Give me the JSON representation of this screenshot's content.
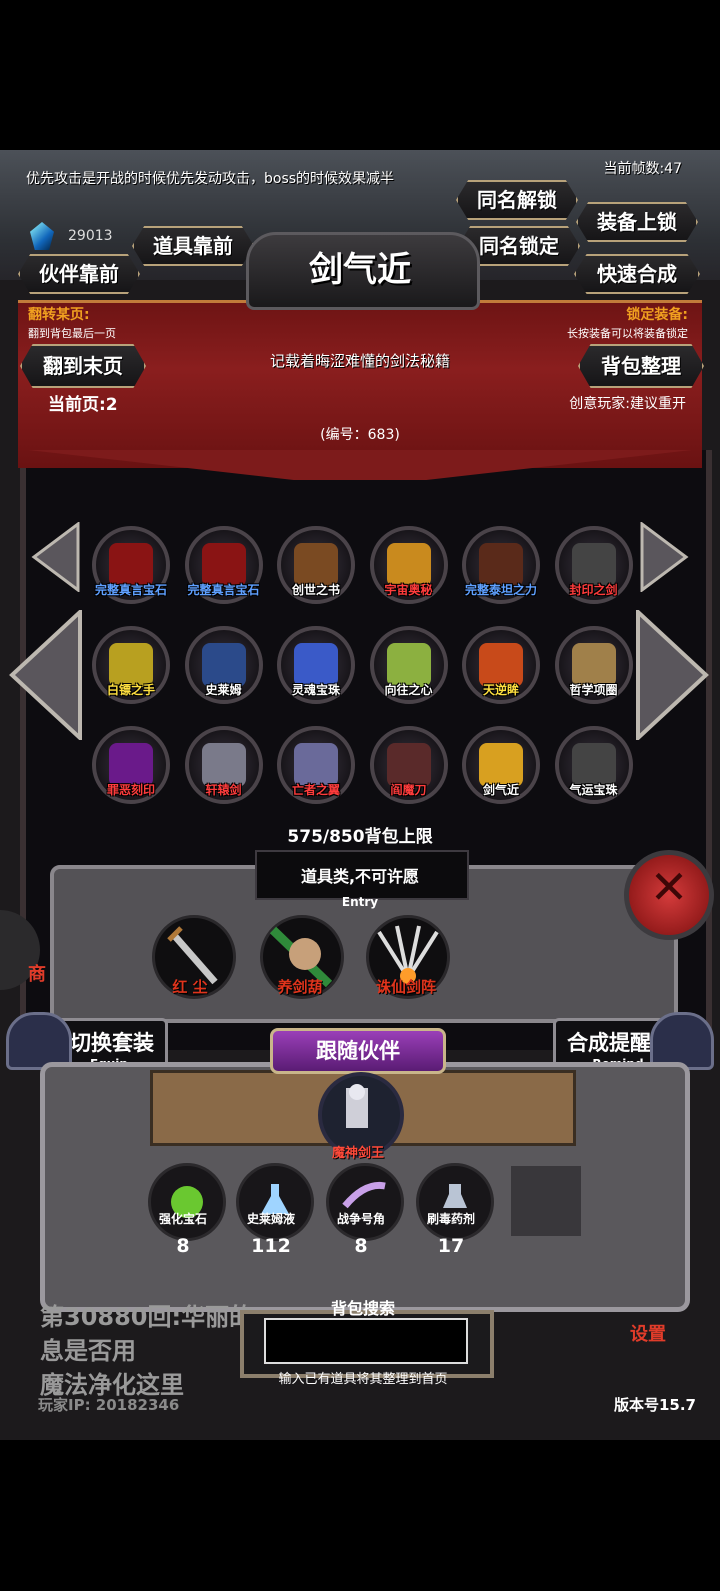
{
  "hud": {
    "tip": "优先攻击是开战的时候优先发动攻击，boss的时候效果减半",
    "fps": "当前帧数:47",
    "coins": "29013"
  },
  "buttons": {
    "name_unlock": "同名解锁",
    "equip_lock": "装备上锁",
    "item_first": "道具靠前",
    "name_lock": "同名锁定",
    "partner_first": "伙伴靠前",
    "quick_merge": "快速合成",
    "last_page": "翻到末页",
    "bag_sort": "背包整理"
  },
  "item_detail": {
    "title": "剑气近",
    "description": "记载着晦涩难懂的剑法秘籍",
    "number": "(编号：683)",
    "flip_label": "翻转某页:",
    "flip_sub": "翻到背包最后一页",
    "lock_label": "锁定装备:",
    "lock_sub": "长按装备可以将装备锁定",
    "current_page": "当前页:2",
    "creative": "创意玩家:建议重开"
  },
  "grid": [
    {
      "label": "完整真言宝石",
      "color": "#5fa0ff"
    },
    {
      "label": "完整真言宝石",
      "color": "#5fa0ff"
    },
    {
      "label": "创世之书",
      "color": "#ffffff"
    },
    {
      "label": "宇宙奥秘",
      "color": "#ff3c3c"
    },
    {
      "label": "完整泰坦之力",
      "color": "#5fa0ff"
    },
    {
      "label": "封印之剑",
      "color": "#ff3c3c"
    },
    {
      "label": "白镖之手",
      "color": "#ffe040"
    },
    {
      "label": "史莱姆",
      "color": "#ffffff"
    },
    {
      "label": "灵魂宝珠",
      "color": "#ffffff"
    },
    {
      "label": "向往之心",
      "color": "#ffffff"
    },
    {
      "label": "天逆眸",
      "color": "#ffe040"
    },
    {
      "label": "哲学项圈",
      "color": "#ffffff"
    },
    {
      "label": "罪恶刻印",
      "color": "#ff3c3c"
    },
    {
      "label": "轩辕剑",
      "color": "#ff3c3c"
    },
    {
      "label": "亡者之翼",
      "color": "#ff3c3c"
    },
    {
      "label": "阎魔刀",
      "color": "#ff3c3c"
    },
    {
      "label": "剑气近",
      "color": "#ffffff"
    },
    {
      "label": "气运宝珠",
      "color": "#ffffff"
    }
  ],
  "bag_limit": "575/850背包上限",
  "entry": {
    "title": "道具类,不可许愿",
    "sub": "Entry",
    "skills": [
      "红 尘",
      "养剑葫",
      "诛仙剑阵"
    ]
  },
  "equip": {
    "label": "切换套装",
    "sub": "Equip"
  },
  "remind": {
    "label": "合成提醒",
    "sub": "Remind"
  },
  "follow": {
    "label": "跟随伙伴",
    "partner": "魔神剑王"
  },
  "inventory": [
    {
      "label": "强化宝石",
      "count": "8"
    },
    {
      "label": "史莱姆液",
      "count": "112"
    },
    {
      "label": "战争号角",
      "count": "8"
    },
    {
      "label": "刷毒药剂",
      "count": "17"
    }
  ],
  "left_partial": "商",
  "story": "第30880回:华丽的　　　　　　　　　　　　　　　　　　　　　　　　　　　　　　　　　　　　　　　　　　　　　　　　　　　　　　　　　　　　　　　　　　　　息是否用",
  "story2": "魔法净化这里",
  "search": {
    "title": "背包搜索",
    "hint": "输入已有道具将其整理到首页",
    "value": ""
  },
  "settings": "设置",
  "player_ip": "玩家IP:  20182346",
  "version": "版本号15.7"
}
